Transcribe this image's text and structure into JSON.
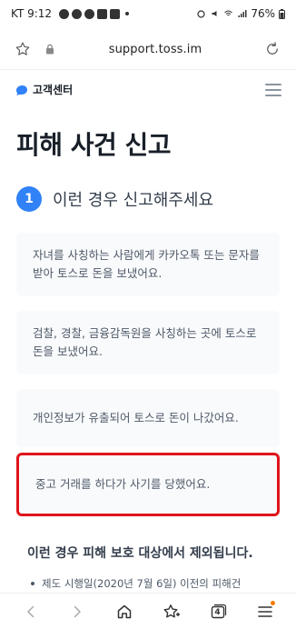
{
  "status_bar": {
    "time_label": "KT 9:12",
    "battery": "76%"
  },
  "browser": {
    "url": "support.toss.im",
    "tab_count": "4"
  },
  "site": {
    "logo_text": "고객센터"
  },
  "page": {
    "title": "피해 사건 신고",
    "step_number": "1",
    "step_label": "이런 경우 신고해주세요",
    "cases": [
      "자녀를 사칭하는 사람에게 카카오톡 또는 문자를\n받아 토스로 돈을 보냈어요.",
      "검찰, 경찰, 금융감독원을 사칭하는 곳에 토스로\n돈을 보냈어요.",
      "개인정보가 유출되어 토스로 돈이 나갔어요.",
      "중고 거래를 하다가 사기를 당했어요."
    ],
    "exclusion_title": "이런 경우 피해 보호 대상에서 제외됩니다.",
    "exclusion_items": [
      "제도 시행일(2020년 7월 6일) 이전의 피해건"
    ]
  },
  "colors": {
    "accent": "#3182f6",
    "highlight_border": "#e0141b"
  }
}
